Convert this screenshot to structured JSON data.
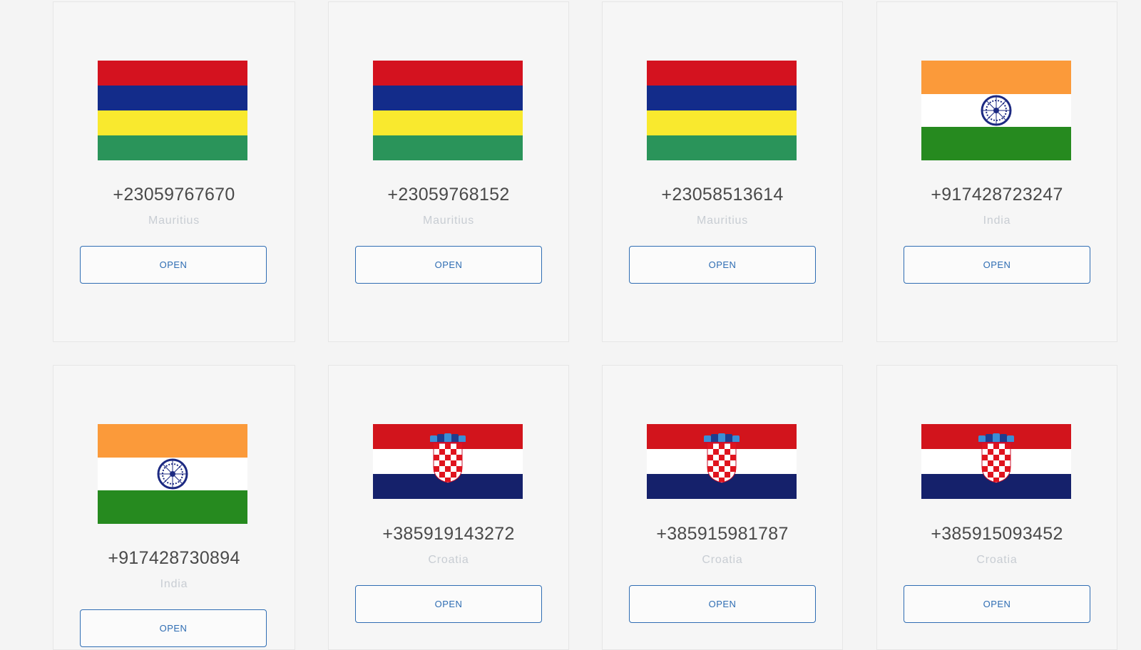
{
  "cards": [
    {
      "number": "+23059767670",
      "country": "Mauritius",
      "flag": "mauritius-flag-icon",
      "button": "OPEN"
    },
    {
      "number": "+23059768152",
      "country": "Mauritius",
      "flag": "mauritius-flag-icon",
      "button": "OPEN"
    },
    {
      "number": "+23058513614",
      "country": "Mauritius",
      "flag": "mauritius-flag-icon",
      "button": "OPEN"
    },
    {
      "number": "+917428723247",
      "country": "India",
      "flag": "india-flag-icon",
      "button": "OPEN"
    },
    {
      "number": "+917428730894",
      "country": "India",
      "flag": "india-flag-icon",
      "button": "OPEN"
    },
    {
      "number": "+385919143272",
      "country": "Croatia",
      "flag": "croatia-flag-icon",
      "button": "OPEN"
    },
    {
      "number": "+385915981787",
      "country": "Croatia",
      "flag": "croatia-flag-icon",
      "button": "OPEN"
    },
    {
      "number": "+385915093452",
      "country": "Croatia",
      "flag": "croatia-flag-icon",
      "button": "OPEN"
    }
  ],
  "colors": {
    "accent": "#2f6db3",
    "mauritius": [
      "#d4121f",
      "#132c8a",
      "#f9e92e",
      "#2a945a"
    ],
    "india": [
      "#fb9a3a",
      "#ffffff",
      "#268a1f",
      "#1d2a82"
    ],
    "croatia": [
      "#d2141c",
      "#ffffff",
      "#15216b"
    ]
  }
}
